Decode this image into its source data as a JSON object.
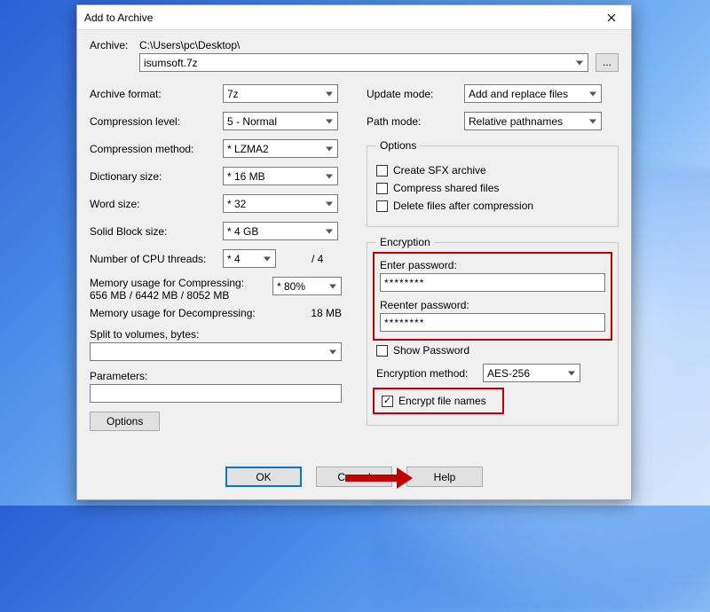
{
  "window": {
    "title": "Add to Archive"
  },
  "archive": {
    "label": "Archive:",
    "path": "C:\\Users\\pc\\Desktop\\",
    "filename": "isumsoft.7z",
    "browse": "..."
  },
  "left": {
    "format_label": "Archive format:",
    "format_value": "7z",
    "level_label": "Compression level:",
    "level_value": "5 - Normal",
    "method_label": "Compression method:",
    "method_value": "* LZMA2",
    "dict_label": "Dictionary size:",
    "dict_value": "* 16 MB",
    "word_label": "Word size:",
    "word_value": "* 32",
    "block_label": "Solid Block size:",
    "block_value": "* 4 GB",
    "cpu_label": "Number of CPU threads:",
    "cpu_value": "* 4",
    "cpu_total": "/ 4",
    "memc_label": "Memory usage for Compressing:",
    "memc_value": "656 MB / 6442 MB / 8052 MB",
    "memc_pct": "* 80%",
    "memd_label": "Memory usage for Decompressing:",
    "memd_value": "18 MB",
    "split_label": "Split to volumes, bytes:",
    "params_label": "Parameters:",
    "options_btn": "Options"
  },
  "right": {
    "update_label": "Update mode:",
    "update_value": "Add and replace files",
    "pathmode_label": "Path mode:",
    "pathmode_value": "Relative pathnames",
    "options_legend": "Options",
    "opt_sfx": "Create SFX archive",
    "opt_shared": "Compress shared files",
    "opt_delete": "Delete files after compression",
    "enc_legend": "Encryption",
    "enter_pw": "Enter password:",
    "reenter_pw": "Reenter password:",
    "pw_masked": "********",
    "show_pw": "Show Password",
    "enc_method_label": "Encryption method:",
    "enc_method_value": "AES-256",
    "encrypt_names": "Encrypt file names"
  },
  "footer": {
    "ok": "OK",
    "cancel": "Cancel",
    "help": "Help"
  }
}
